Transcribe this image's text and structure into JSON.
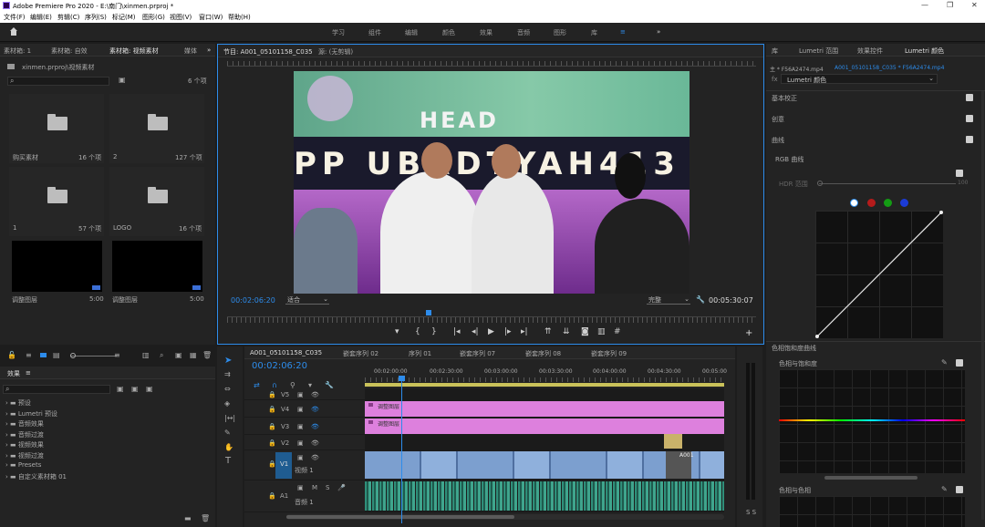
{
  "app": {
    "title": "Adobe Premiere Pro 2020 - E:\\南门\\xinmen.prproj *",
    "min": "—",
    "max": "❐",
    "close": "✕"
  },
  "menu": [
    "文件(F)",
    "编辑(E)",
    "剪辑(C)",
    "序列(S)",
    "标记(M)",
    "图形(G)",
    "视图(V)",
    "窗口(W)",
    "帮助(H)"
  ],
  "workspaces": [
    "学习",
    "组件",
    "编辑",
    "颜色",
    "效果",
    "音频",
    "图形",
    "库",
    "≡",
    "»"
  ],
  "project": {
    "tabs": [
      "素材箱: 1",
      "素材箱: 自效",
      "素材箱: 视频素材",
      "媒体"
    ],
    "path": "xinmen.prproj\\视频素材",
    "count": "6 个项",
    "bins": [
      {
        "name": "购买素材",
        "n": "16 个项"
      },
      {
        "name": "2",
        "n": "127 个项"
      },
      {
        "name": "1",
        "n": "57 个项"
      },
      {
        "name": "LOGO",
        "n": "16 个项"
      }
    ],
    "adj": [
      {
        "name": "调整图层",
        "dur": "5:00"
      },
      {
        "name": "调整图层",
        "dur": "5:00"
      }
    ]
  },
  "effects": {
    "tab": "效果",
    "items": [
      "预设",
      "Lumetri 预设",
      "音频效果",
      "音频过渡",
      "视频效果",
      "视频过渡",
      "Presets",
      "自定义素材箱 01"
    ]
  },
  "program": {
    "tab1": "节目: A001_05101158_C035",
    "tab2": "源: (无剪辑)",
    "tc_left": "00:02:06:20",
    "fit": "适合",
    "quality": "完整",
    "tc_right": "00:05:30:07"
  },
  "timeline": {
    "tabs": [
      "A001_05101158_C035",
      "嵌套序列 02",
      "序列 01",
      "嵌套序列 07",
      "嵌套序列 08",
      "嵌套序列 09"
    ],
    "tc": "00:02:06:20",
    "ruler": [
      "00:02:00:00",
      "00:02:30:00",
      "00:03:00:00",
      "00:03:30:00",
      "00:04:00:00",
      "00:04:30:00",
      "00:05:00"
    ],
    "tracks": [
      "V5",
      "V4",
      "V3",
      "V2",
      "V1",
      "A1"
    ],
    "v1name": "视频 1",
    "a1name": "音频 1",
    "clip": "调整图层",
    "clipv": "A001"
  },
  "lumetri": {
    "tabs": [
      "库",
      "Lumetri 范围",
      "效果控件",
      "Lumetri 颜色"
    ],
    "src": "主 * F56A2474.mp4",
    "seq": "A001_05101158_C035 * F56A2474.mp4",
    "name": "Lumetri 颜色",
    "sections": [
      "基本校正",
      "创意",
      "曲线",
      "RGB 曲线",
      "HDR 范围",
      "色相饱和度曲线",
      "色相与饱和度",
      "色相与色相"
    ],
    "hdr_val": "100"
  },
  "colors": {
    "accent": "#2d8ceb",
    "pink": "#dd80dd",
    "blue": "#7c9fcf",
    "green": "#2f8f7a"
  }
}
